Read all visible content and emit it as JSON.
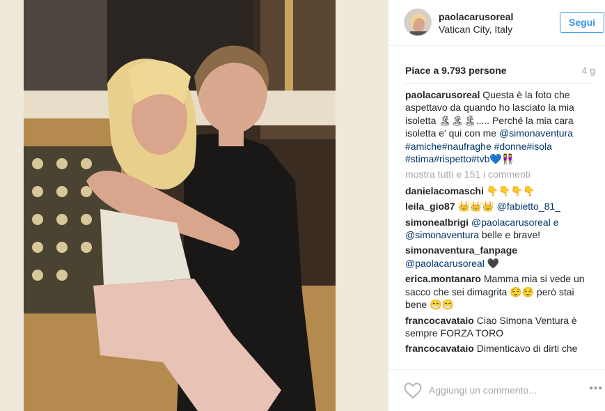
{
  "post": {
    "username": "paolacarusoreal",
    "location": "Vatican City, Italy",
    "follow_label": "Segui",
    "likes_text": "Piace a 9.793 persone",
    "time_ago": "4 g"
  },
  "caption": {
    "user": "paolacarusoreal",
    "text_1": " Questa è la foto che aspettavo da quando ho lasciato la mia isoletta 🏝🏝🏝..... Perché la mia cara isoletta e' qui con me ",
    "tags": "@simonaventura #amiche#naufraghe #donne#isola #stima#rispetto#tvb",
    "emoji": "💙👭"
  },
  "show_all": "mostra tutti e 151 i commenti",
  "comments": [
    {
      "user": "danielacomaschi",
      "text": " 👇👇👇👇",
      "tag": ""
    },
    {
      "user": "leila_gio87",
      "text": " 👑👑👑 ",
      "tag": "@fabietto_81_"
    },
    {
      "user": "simonealbrigi",
      "text": " belle e brave!",
      "tag": "@paolacarusoreal e @simonaventura"
    },
    {
      "user": "simonaventura_fanpage",
      "text": " 🖤",
      "tag": "@paolacarusoreal"
    },
    {
      "user": "erica.montanaro",
      "text": " Mamma mia si vede un sacco che sei dimagrita 😌😌 però stai bene 😁😁",
      "tag": ""
    },
    {
      "user": "francocavataio",
      "text": " Ciao Simona Ventura è sempre FORZA TORO",
      "tag": ""
    },
    {
      "user": "francocavataio",
      "text": " Dimenticavo di dirti che",
      "tag": ""
    }
  ],
  "footer": {
    "comment_placeholder": "Aggiungi un commento...",
    "more_label": "•••",
    "heart_icon": "heart-outline-icon"
  },
  "colors": {
    "follow_blue": "#3897f0",
    "tag_blue": "#003569",
    "muted": "#a5a7aa"
  }
}
